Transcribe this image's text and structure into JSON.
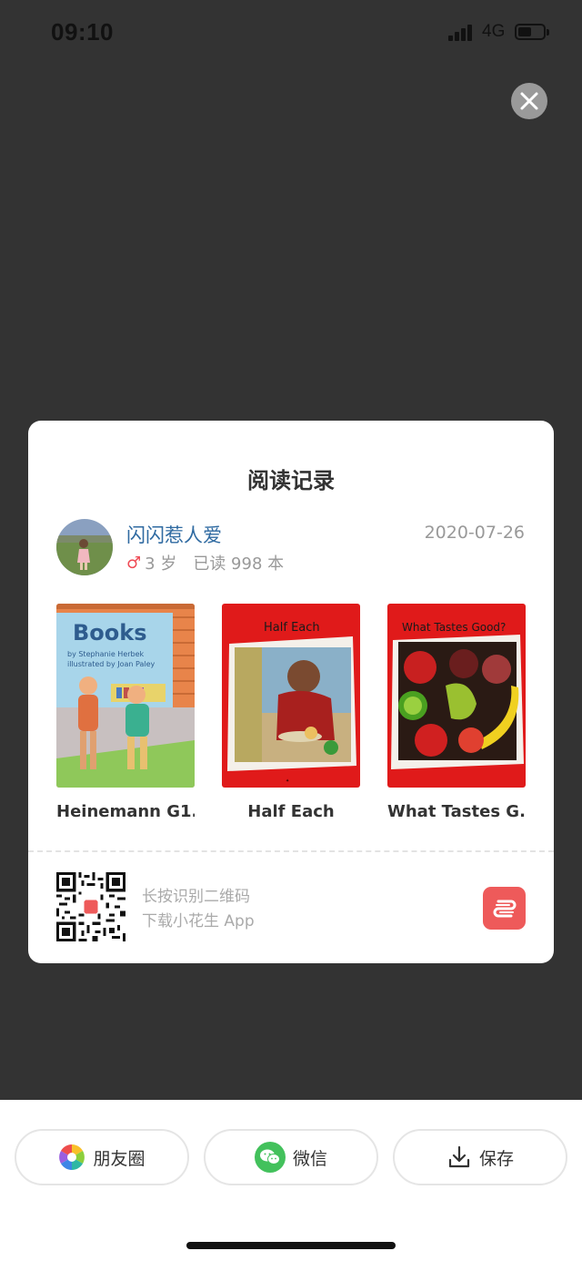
{
  "status_bar": {
    "time": "09:10",
    "network": "4G"
  },
  "card": {
    "title": "阅读记录",
    "user": {
      "name": "闪闪惹人爱",
      "gender_symbol": "♂",
      "age": "3 岁",
      "read_count": "已读 998 本"
    },
    "date": "2020-07-26",
    "books": [
      {
        "title": "Heinemann G1...",
        "cover_title": "Books",
        "cover_sub1": "by Stephanie Herbek",
        "cover_sub2": "illustrated by Joan Paley"
      },
      {
        "title": "Half Each",
        "cover_title": "Half Each"
      },
      {
        "title": "What Tastes G...",
        "cover_title": "What Tastes Good?"
      }
    ],
    "qr_hint_line1": "长按识别二维码",
    "qr_hint_line2": "下载小花生 App"
  },
  "actions": {
    "moments": "朋友圈",
    "wechat": "微信",
    "save": "保存"
  },
  "colors": {
    "accent_name": "#2f6aa1",
    "gender": "#ef4b55",
    "logo": "#ee5a5a",
    "cover_red": "#e01a1a"
  }
}
